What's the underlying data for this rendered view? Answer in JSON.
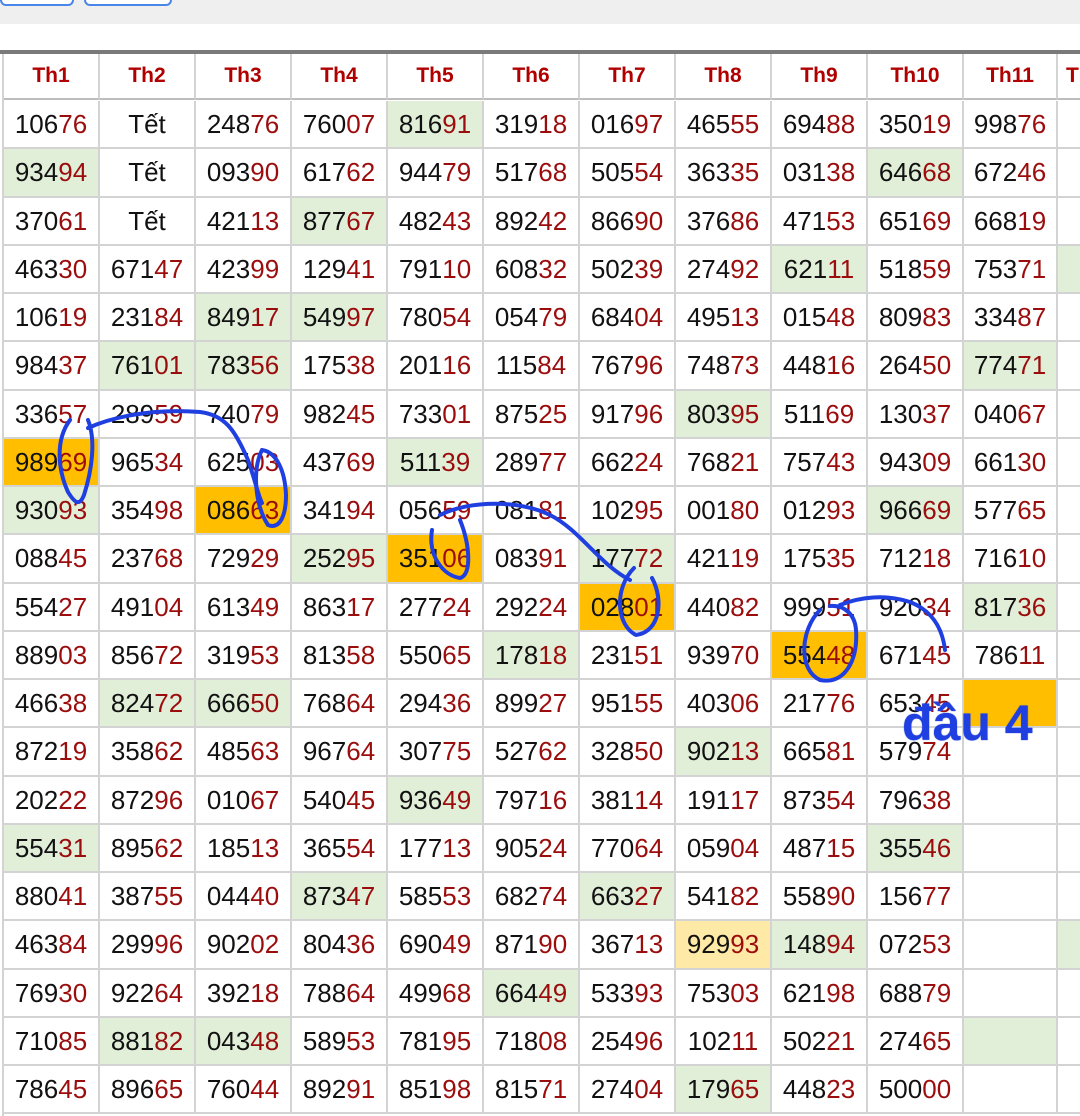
{
  "headers": [
    "Th1",
    "Th2",
    "Th3",
    "Th4",
    "Th5",
    "Th6",
    "Th7",
    "Th8",
    "Th9",
    "Th10",
    "Th11",
    "T"
  ],
  "rows": [
    [
      "10676",
      "Tết",
      "24876",
      "76007",
      "81691",
      "31918",
      "01697",
      "46555",
      "69488",
      "35019",
      "99876",
      ""
    ],
    [
      "93494",
      "Tết",
      "09390",
      "61762",
      "94479",
      "51768",
      "50554",
      "36335",
      "03138",
      "64668",
      "67246",
      ""
    ],
    [
      "37061",
      "Tết",
      "42113",
      "87767",
      "48243",
      "89242",
      "86690",
      "37686",
      "47153",
      "65169",
      "66819",
      ""
    ],
    [
      "46330",
      "67147",
      "42399",
      "12941",
      "79110",
      "60832",
      "50239",
      "27492",
      "62111",
      "51859",
      "75371",
      ""
    ],
    [
      "10619",
      "23184",
      "84917",
      "54997",
      "78054",
      "05479",
      "68404",
      "49513",
      "01548",
      "80983",
      "33487",
      ""
    ],
    [
      "98437",
      "76101",
      "78356",
      "17538",
      "20116",
      "11584",
      "76796",
      "74873",
      "44816",
      "26450",
      "77471",
      ""
    ],
    [
      "33657",
      "28959",
      "74079",
      "98245",
      "73301",
      "87525",
      "91796",
      "80395",
      "51169",
      "13037",
      "04067",
      ""
    ],
    [
      "98969",
      "96534",
      "62503",
      "43769",
      "51139",
      "28977",
      "66224",
      "76821",
      "75743",
      "94309",
      "66130",
      ""
    ],
    [
      "93093",
      "35498",
      "08663",
      "34194",
      "05659",
      "08181",
      "10295",
      "00180",
      "01293",
      "96669",
      "57765",
      ""
    ],
    [
      "08845",
      "23768",
      "72929",
      "25295",
      "35106",
      "08391",
      "17772",
      "42119",
      "17535",
      "71218",
      "71610",
      ""
    ],
    [
      "55427",
      "49104",
      "61349",
      "86317",
      "27724",
      "29224",
      "02801",
      "44082",
      "99951",
      "92034",
      "81736",
      ""
    ],
    [
      "88903",
      "85672",
      "31953",
      "81358",
      "55065",
      "17818",
      "23151",
      "93970",
      "55448",
      "67145",
      "78611",
      ""
    ],
    [
      "46638",
      "82472",
      "66650",
      "76864",
      "29436",
      "89927",
      "95155",
      "40306",
      "21776",
      "65345",
      "",
      ""
    ],
    [
      "87219",
      "35862",
      "48563",
      "96764",
      "30775",
      "52762",
      "32850",
      "90213",
      "66581",
      "57974",
      "",
      ""
    ],
    [
      "20222",
      "87296",
      "01067",
      "54045",
      "93649",
      "79716",
      "38114",
      "19117",
      "87354",
      "79638",
      "",
      ""
    ],
    [
      "55431",
      "89562",
      "18513",
      "36554",
      "17713",
      "90524",
      "77064",
      "05904",
      "48715",
      "35546",
      "",
      ""
    ],
    [
      "88041",
      "38755",
      "04440",
      "87347",
      "58553",
      "68274",
      "66327",
      "54182",
      "55890",
      "15677",
      "",
      ""
    ],
    [
      "46384",
      "29996",
      "90202",
      "80436",
      "69049",
      "87190",
      "36713",
      "92993",
      "14894",
      "07253",
      "",
      ""
    ],
    [
      "76930",
      "92264",
      "39218",
      "78864",
      "49968",
      "66449",
      "53393",
      "75303",
      "62198",
      "68879",
      "",
      ""
    ],
    [
      "71085",
      "88182",
      "04348",
      "58953",
      "78195",
      "71808",
      "25496",
      "10211",
      "50221",
      "27465",
      "",
      ""
    ],
    [
      "78645",
      "89665",
      "76044",
      "89291",
      "85198",
      "81571",
      "27404",
      "17965",
      "44823",
      "50000",
      "",
      ""
    ]
  ],
  "highlights": {
    "green": [
      [
        1,
        0
      ],
      [
        4,
        2
      ],
      [
        4,
        3
      ],
      [
        9,
        6
      ],
      [
        10,
        6
      ],
      [
        10,
        10
      ],
      [
        1,
        9
      ],
      [
        0,
        4
      ],
      [
        2,
        3
      ],
      [
        3,
        8
      ],
      [
        3,
        11
      ],
      [
        5,
        1
      ],
      [
        5,
        2
      ],
      [
        5,
        10
      ],
      [
        6,
        7
      ],
      [
        7,
        4
      ],
      [
        8,
        0
      ],
      [
        8,
        9
      ],
      [
        9,
        3
      ],
      [
        11,
        5
      ],
      [
        11,
        8
      ],
      [
        12,
        1
      ],
      [
        12,
        2
      ],
      [
        13,
        7
      ],
      [
        14,
        4
      ],
      [
        15,
        0
      ],
      [
        15,
        9
      ],
      [
        16,
        3
      ],
      [
        16,
        6
      ],
      [
        17,
        8
      ],
      [
        17,
        11
      ],
      [
        18,
        5
      ],
      [
        19,
        1
      ],
      [
        19,
        2
      ],
      [
        19,
        10
      ],
      [
        20,
        7
      ]
    ],
    "orange": [
      [
        7,
        0
      ],
      [
        8,
        2
      ],
      [
        9,
        4
      ],
      [
        10,
        6
      ],
      [
        11,
        8
      ],
      [
        12,
        10
      ]
    ],
    "yellow": [
      [
        17,
        7
      ]
    ]
  },
  "annotation": {
    "text": "đầu 4",
    "color": "#1f3fe0"
  }
}
